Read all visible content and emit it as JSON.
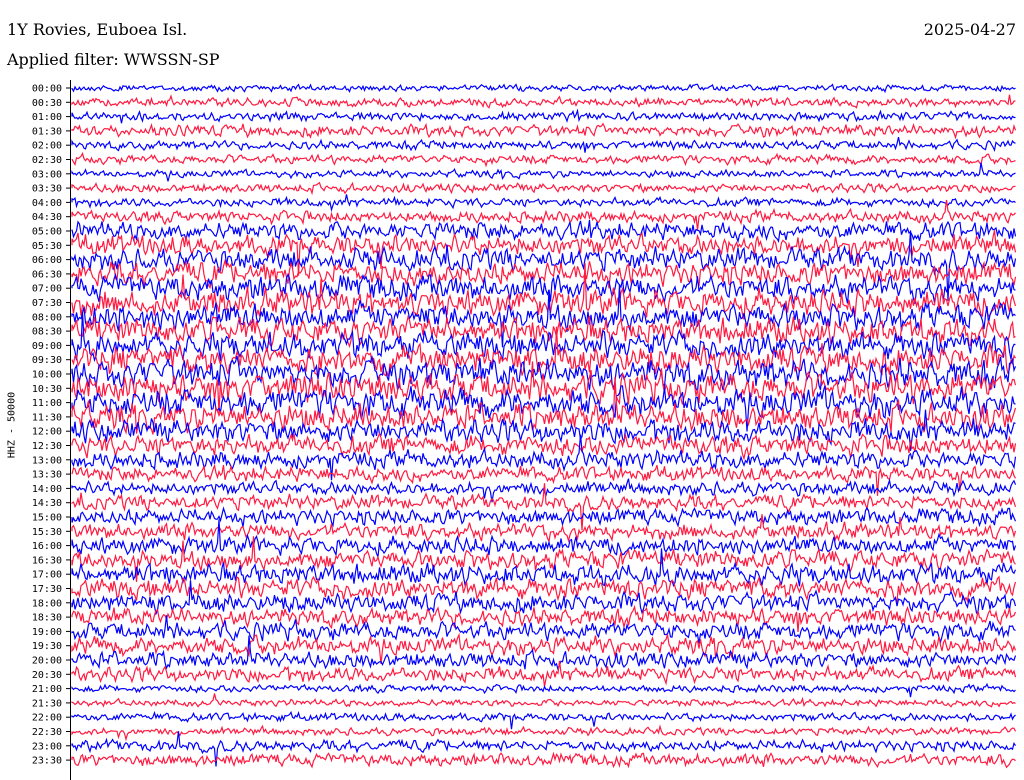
{
  "header": {
    "station": "1Y Rovies, Euboea Isl.",
    "filter": "Applied filter: WWSSN-SP",
    "date": "2025-04-27"
  },
  "chart_data": {
    "type": "helicorder",
    "ylabel": "HHZ - 50000",
    "row_labels": [
      "00:00",
      "00:30",
      "01:00",
      "01:30",
      "02:00",
      "02:30",
      "03:00",
      "03:30",
      "04:00",
      "04:30",
      "05:00",
      "05:30",
      "06:00",
      "06:30",
      "07:00",
      "07:30",
      "08:00",
      "08:30",
      "09:00",
      "09:30",
      "10:00",
      "10:30",
      "11:00",
      "11:30",
      "12:00",
      "12:30",
      "13:00",
      "13:30",
      "14:00",
      "14:30",
      "15:00",
      "15:30",
      "16:00",
      "16:30",
      "17:00",
      "17:30",
      "18:00",
      "18:30",
      "19:00",
      "19:30",
      "20:00",
      "20:30",
      "21:00",
      "21:30",
      "22:00",
      "22:30",
      "23:00",
      "23:30"
    ],
    "trace_colors": [
      "#0000ff",
      "#ff1a40"
    ],
    "row_amplitude": [
      0.45,
      0.6,
      0.6,
      0.8,
      0.6,
      0.6,
      0.5,
      0.6,
      0.6,
      0.8,
      1.2,
      1.4,
      1.5,
      1.6,
      1.7,
      1.8,
      1.8,
      1.8,
      1.8,
      1.9,
      2.0,
      2.0,
      1.9,
      1.8,
      1.6,
      1.4,
      1.2,
      1.0,
      0.9,
      1.0,
      1.1,
      1.1,
      1.2,
      1.3,
      1.4,
      1.4,
      1.3,
      1.2,
      1.2,
      1.2,
      1.1,
      1.0,
      0.5,
      0.45,
      0.55,
      0.5,
      0.75,
      0.85
    ]
  }
}
